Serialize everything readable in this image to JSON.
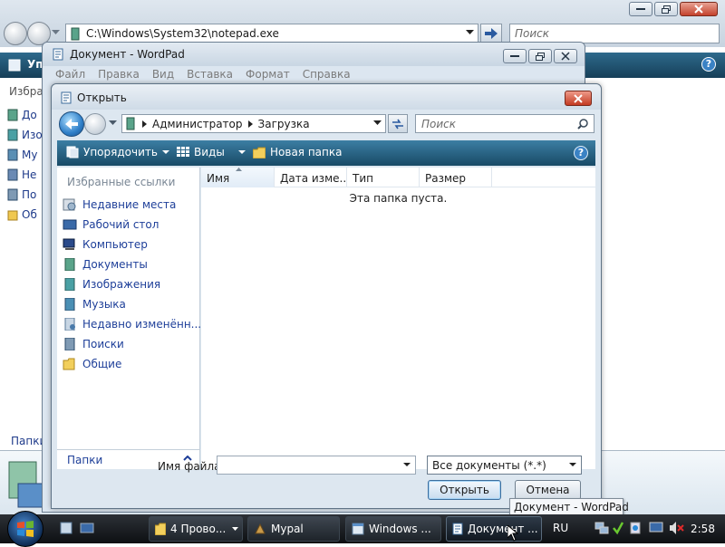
{
  "background_explorer": {
    "address": "C:\\Windows\\System32\\notepad.exe",
    "search_placeholder": "Поиск",
    "toolbar_partial": "Упо",
    "help_label": "?",
    "left_heading_partial": "Избра",
    "left_items_partial": [
      "До",
      "Изо",
      "Му",
      "Не",
      "По",
      "Об"
    ],
    "folders_label": "Папки"
  },
  "wordpad": {
    "title": "Документ - WordPad",
    "menu": [
      "Файл",
      "Правка",
      "Вид",
      "Вставка",
      "Формат",
      "Справка"
    ]
  },
  "dialog": {
    "title": "Открыть",
    "breadcrumb": [
      "Администратор",
      "Загрузка"
    ],
    "search_placeholder": "Поиск",
    "commands": {
      "organize": "Упорядочить",
      "views": "Виды",
      "new_folder": "Новая папка",
      "help": "?"
    },
    "favorites_heading": "Избранные ссылки",
    "favorites": [
      {
        "label": "Недавние места",
        "icon": "recent-places-icon"
      },
      {
        "label": "Рабочий стол",
        "icon": "desktop-icon"
      },
      {
        "label": "Компьютер",
        "icon": "computer-icon"
      },
      {
        "label": "Документы",
        "icon": "documents-icon"
      },
      {
        "label": "Изображения",
        "icon": "pictures-icon"
      },
      {
        "label": "Музыка",
        "icon": "music-icon"
      },
      {
        "label": "Недавно изменённ...",
        "icon": "recently-changed-icon"
      },
      {
        "label": "Поиски",
        "icon": "searches-icon"
      },
      {
        "label": "Общие",
        "icon": "public-folder-icon"
      }
    ],
    "folders_toggle": "Папки",
    "columns": [
      "Имя",
      "Дата изме...",
      "Тип",
      "Размер"
    ],
    "empty_message": "Эта папка пуста.",
    "filename_label": "Имя файла:",
    "filename_value": "",
    "filter_value": "Все документы (*.*)",
    "open_button": "Открыть",
    "cancel_button": "Отмена"
  },
  "tooltip": "Документ - WordPad",
  "taskbar": {
    "buttons": [
      {
        "label": "4 Прово...",
        "icon": "folder-icon"
      },
      {
        "label": "Mypal",
        "icon": "mypal-icon"
      },
      {
        "label": "Windows ...",
        "icon": "window-icon"
      },
      {
        "label": "Документ ...",
        "icon": "wordpad-icon"
      }
    ],
    "language": "RU",
    "clock": "2:58"
  }
}
